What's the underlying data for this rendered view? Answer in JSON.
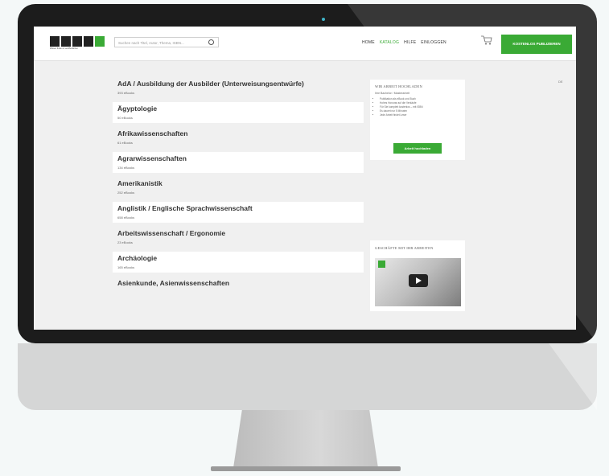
{
  "header": {
    "logo_sub": "Wissen finden & veröffentlichen",
    "search_placeholder": "Suchen nach Titel, Autor, Thema, ISBN...",
    "nav": [
      "HOME",
      "KATALOG",
      "HILFE",
      "EINLOGGEN"
    ],
    "cta": "KOSTENLOS PUBLIZIEREN"
  },
  "categories": [
    {
      "title": "AdA / Ausbildung der Ausbilder (Unterweisungsentwürfe)",
      "count": "393 eBooks"
    },
    {
      "title": "Ägyptologie",
      "count": "50 eBooks"
    },
    {
      "title": "Afrikawissenschaften",
      "count": "61 eBooks"
    },
    {
      "title": "Agrarwissenschaften",
      "count": "134 eBooks"
    },
    {
      "title": "Amerikanistik",
      "count": "252 eBooks"
    },
    {
      "title": "Anglistik / Englische Sprachwissenschaft",
      "count": "658 eBooks"
    },
    {
      "title": "Arbeitswissenschaft / Ergonomie",
      "count": "23 eBooks"
    },
    {
      "title": "Archäologie",
      "count": "165 eBooks"
    },
    {
      "title": "Asienkunde, Asienwissenschaften",
      "count": ""
    }
  ],
  "sidebar": {
    "box1_heading": "WIR ARBEIT HOCHLADEN",
    "box1_text": "Ihre Bachelor / Masterarbeit",
    "box1_bullets": [
      "Publikation als eBook und Buch",
      "Hohes Honorar auf die Verkäufe",
      "Für Sie komplett kostenlos – mit ISBN",
      "Es dauert nur 5 Minuten",
      "Jede Arbeit findet Leser"
    ],
    "box1_button": "Arbeit hochladen",
    "box2_heading": "GESCHÄFTE MIT IHR ARBEITEN"
  },
  "lang": "DE"
}
